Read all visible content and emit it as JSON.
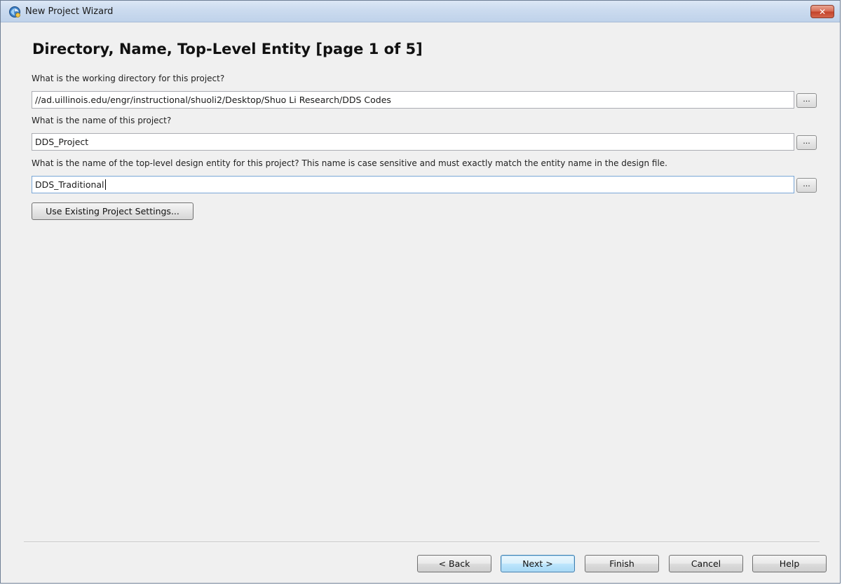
{
  "window": {
    "title": "New Project Wizard",
    "close_label": "✕"
  },
  "page": {
    "heading": "Directory, Name, Top-Level Entity [page 1 of 5]"
  },
  "fields": {
    "directory": {
      "label": "What is the working directory for this project?",
      "value": "//ad.uillinois.edu/engr/instructional/shuoli2/Desktop/Shuo Li Research/DDS Codes",
      "browse_label": "..."
    },
    "project_name": {
      "label": "What is the name of this project?",
      "value": "DDS_Project",
      "browse_label": "..."
    },
    "top_entity": {
      "label": "What is the name of the top-level design entity for this project? This name is case sensitive and must exactly match the entity name in the design file.",
      "value": "DDS_Traditional",
      "browse_label": "..."
    }
  },
  "actions": {
    "use_existing_settings": "Use Existing Project Settings..."
  },
  "footer": {
    "back": "< Back",
    "next": "Next >",
    "finish": "Finish",
    "cancel": "Cancel",
    "help": "Help"
  },
  "colors": {
    "titlebar": "#cbdbef",
    "close_button": "#c4442c",
    "dialog_background": "#f0f0f0",
    "default_button_border": "#3c7fb1"
  },
  "icons": {
    "app": "quartus-wizard-icon",
    "close": "close-icon"
  }
}
